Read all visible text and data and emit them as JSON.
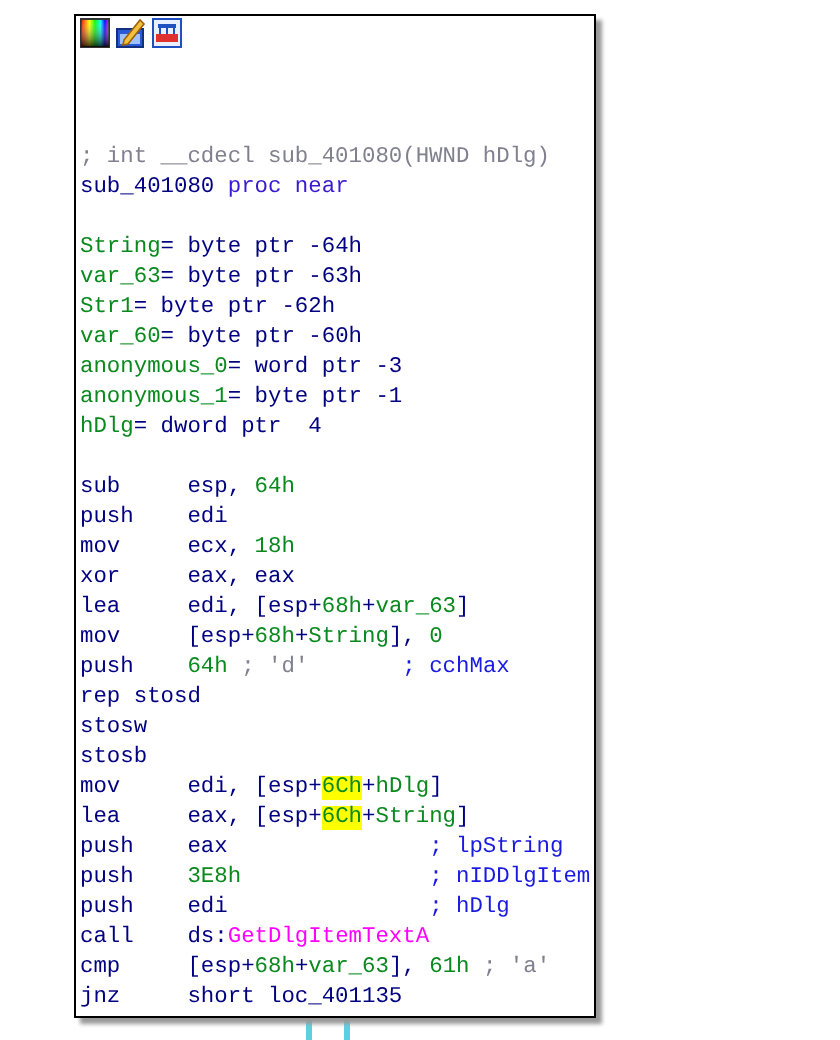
{
  "node": {
    "toolbar": [
      {
        "kind": "palette"
      },
      {
        "kind": "edit"
      },
      {
        "kind": "graph"
      }
    ],
    "lines": [
      {
        "kind": "code",
        "segments": [
          {
            "text": "; int __cdecl sub_401080(HWND hDlg)",
            "kind": "header"
          }
        ]
      },
      {
        "kind": "code",
        "segments": [
          {
            "text": "sub_401080 ",
            "kind": "label"
          },
          {
            "text": "proc near",
            "kind": "keyword"
          }
        ]
      },
      {
        "kind": "blank"
      },
      {
        "kind": "code",
        "segments": [
          {
            "text": "String",
            "kind": "name"
          },
          {
            "text": "= byte ptr -64h",
            "kind": "op"
          }
        ]
      },
      {
        "kind": "code",
        "segments": [
          {
            "text": "var_63",
            "kind": "name"
          },
          {
            "text": "= byte ptr -63h",
            "kind": "op"
          }
        ]
      },
      {
        "kind": "code",
        "segments": [
          {
            "text": "Str1",
            "kind": "name"
          },
          {
            "text": "= byte ptr -62h",
            "kind": "op"
          }
        ]
      },
      {
        "kind": "code",
        "segments": [
          {
            "text": "var_60",
            "kind": "name"
          },
          {
            "text": "= byte ptr -60h",
            "kind": "op"
          }
        ]
      },
      {
        "kind": "code",
        "segments": [
          {
            "text": "anonymous_0",
            "kind": "name"
          },
          {
            "text": "= word ptr -3",
            "kind": "op"
          }
        ]
      },
      {
        "kind": "code",
        "segments": [
          {
            "text": "anonymous_1",
            "kind": "name"
          },
          {
            "text": "= byte ptr -1",
            "kind": "op"
          }
        ]
      },
      {
        "kind": "code",
        "segments": [
          {
            "text": "hDlg",
            "kind": "name"
          },
          {
            "text": "= dword ptr  4",
            "kind": "op"
          }
        ]
      },
      {
        "kind": "blank"
      },
      {
        "kind": "code",
        "segments": [
          {
            "text": "sub     esp, ",
            "kind": "op"
          },
          {
            "text": "64h",
            "kind": "num"
          }
        ]
      },
      {
        "kind": "code",
        "segments": [
          {
            "text": "push    edi",
            "kind": "op"
          }
        ]
      },
      {
        "kind": "code",
        "segments": [
          {
            "text": "mov     ecx, ",
            "kind": "op"
          },
          {
            "text": "18h",
            "kind": "num"
          }
        ]
      },
      {
        "kind": "code",
        "segments": [
          {
            "text": "xor     eax, eax",
            "kind": "op"
          }
        ]
      },
      {
        "kind": "code",
        "segments": [
          {
            "text": "lea     edi, [esp+",
            "kind": "op"
          },
          {
            "text": "68h",
            "kind": "num"
          },
          {
            "text": "+",
            "kind": "op"
          },
          {
            "text": "var_63",
            "kind": "name"
          },
          {
            "text": "]",
            "kind": "op"
          }
        ]
      },
      {
        "kind": "code",
        "segments": [
          {
            "text": "mov     [esp+",
            "kind": "op"
          },
          {
            "text": "68h",
            "kind": "num"
          },
          {
            "text": "+",
            "kind": "op"
          },
          {
            "text": "String",
            "kind": "name"
          },
          {
            "text": "], ",
            "kind": "op"
          },
          {
            "text": "0",
            "kind": "num"
          }
        ]
      },
      {
        "kind": "code",
        "segments": [
          {
            "text": "push    ",
            "kind": "op"
          },
          {
            "text": "64h",
            "kind": "num"
          },
          {
            "text": " ; 'd'       ",
            "kind": "header"
          },
          {
            "text": "; cchMax",
            "kind": "comment"
          }
        ]
      },
      {
        "kind": "code",
        "segments": [
          {
            "text": "rep stosd",
            "kind": "op"
          }
        ]
      },
      {
        "kind": "code",
        "segments": [
          {
            "text": "stosw",
            "kind": "op"
          }
        ]
      },
      {
        "kind": "code",
        "segments": [
          {
            "text": "stosb",
            "kind": "op"
          }
        ]
      },
      {
        "kind": "code",
        "segments": [
          {
            "text": "mov     edi, [esp+",
            "kind": "op"
          },
          {
            "text": "6Ch",
            "kind": "highlight"
          },
          {
            "text": "+",
            "kind": "op"
          },
          {
            "text": "hDlg",
            "kind": "name"
          },
          {
            "text": "]",
            "kind": "op"
          }
        ]
      },
      {
        "kind": "code",
        "segments": [
          {
            "text": "lea     eax, [esp+",
            "kind": "op"
          },
          {
            "text": "6Ch",
            "kind": "highlight"
          },
          {
            "text": "+",
            "kind": "op"
          },
          {
            "text": "String",
            "kind": "name"
          },
          {
            "text": "]",
            "kind": "op"
          }
        ]
      },
      {
        "kind": "code",
        "segments": [
          {
            "text": "push    eax               ",
            "kind": "op"
          },
          {
            "text": "; lpString",
            "kind": "comment"
          }
        ]
      },
      {
        "kind": "code",
        "segments": [
          {
            "text": "push    ",
            "kind": "op"
          },
          {
            "text": "3E8h",
            "kind": "num"
          },
          {
            "text": "              ; nIDDlgItem",
            "kind": "comment"
          }
        ]
      },
      {
        "kind": "code",
        "segments": [
          {
            "text": "push    edi               ",
            "kind": "op"
          },
          {
            "text": "; hDlg",
            "kind": "comment"
          }
        ]
      },
      {
        "kind": "code",
        "segments": [
          {
            "text": "call    ds:",
            "kind": "op"
          },
          {
            "text": "GetDlgItemTextA",
            "kind": "func"
          }
        ]
      },
      {
        "kind": "code",
        "segments": [
          {
            "text": "cmp     [esp+",
            "kind": "op"
          },
          {
            "text": "68h",
            "kind": "num"
          },
          {
            "text": "+",
            "kind": "op"
          },
          {
            "text": "var_63",
            "kind": "name"
          },
          {
            "text": "], ",
            "kind": "op"
          },
          {
            "text": "61h",
            "kind": "num"
          },
          {
            "text": " ; 'a'",
            "kind": "header"
          }
        ]
      },
      {
        "kind": "code",
        "segments": [
          {
            "text": "jnz     short loc_401135",
            "kind": "op"
          }
        ]
      }
    ]
  },
  "edges": [
    {
      "kind": "connector"
    },
    {
      "kind": "connector"
    }
  ]
}
